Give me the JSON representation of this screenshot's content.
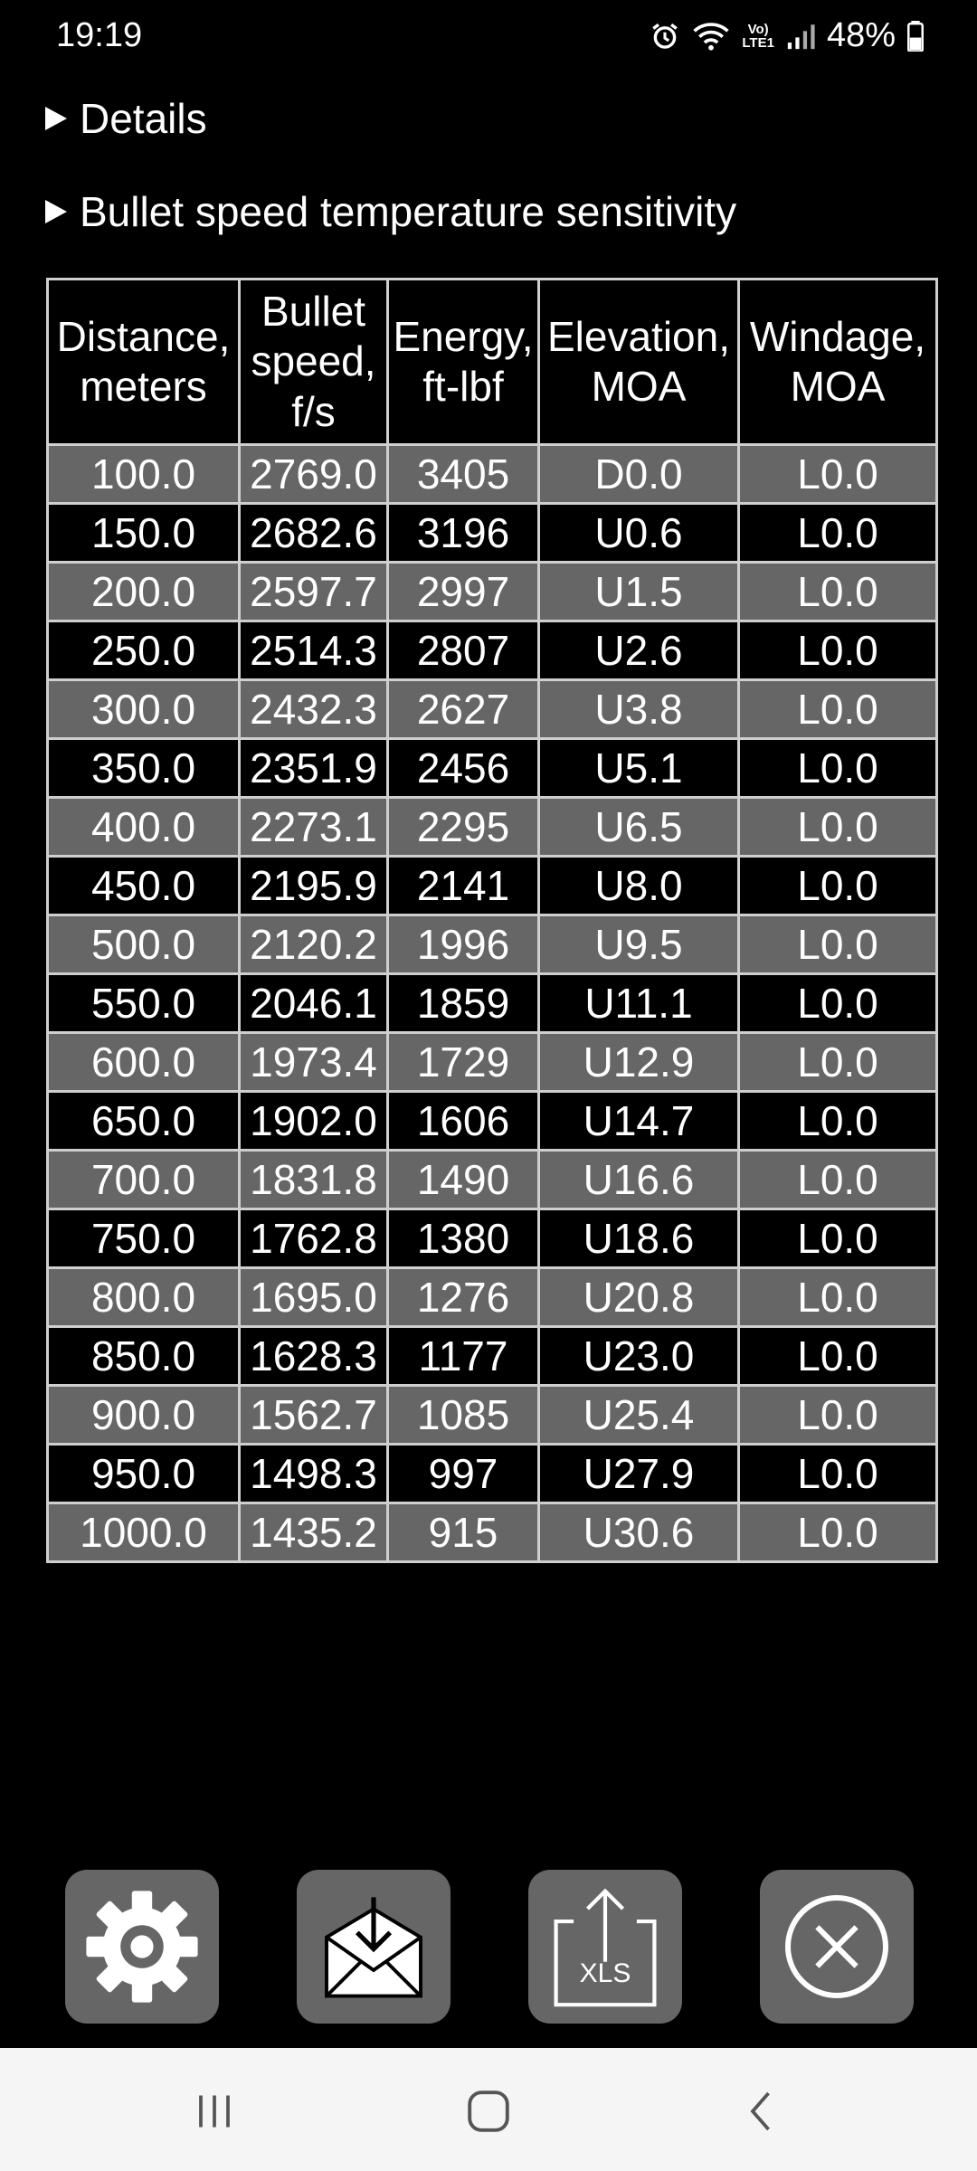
{
  "status_bar": {
    "time": "19:19",
    "net_top": "Vo)",
    "net_bottom": "LTE1",
    "battery": "48%"
  },
  "details": {
    "label": "Details"
  },
  "sensitivity": {
    "label": "Bullet speed temperature sensitivity"
  },
  "table": {
    "headers": [
      "Distance,\nmeters",
      "Bullet\nspeed,\nf/s",
      "Energy,\nft-lbf",
      "Elevation,\nMOA",
      "Windage,\nMOA"
    ],
    "rows": [
      [
        "100.0",
        "2769.0",
        "3405",
        "D0.0",
        "L0.0"
      ],
      [
        "150.0",
        "2682.6",
        "3196",
        "U0.6",
        "L0.0"
      ],
      [
        "200.0",
        "2597.7",
        "2997",
        "U1.5",
        "L0.0"
      ],
      [
        "250.0",
        "2514.3",
        "2807",
        "U2.6",
        "L0.0"
      ],
      [
        "300.0",
        "2432.3",
        "2627",
        "U3.8",
        "L0.0"
      ],
      [
        "350.0",
        "2351.9",
        "2456",
        "U5.1",
        "L0.0"
      ],
      [
        "400.0",
        "2273.1",
        "2295",
        "U6.5",
        "L0.0"
      ],
      [
        "450.0",
        "2195.9",
        "2141",
        "U8.0",
        "L0.0"
      ],
      [
        "500.0",
        "2120.2",
        "1996",
        "U9.5",
        "L0.0"
      ],
      [
        "550.0",
        "2046.1",
        "1859",
        "U11.1",
        "L0.0"
      ],
      [
        "600.0",
        "1973.4",
        "1729",
        "U12.9",
        "L0.0"
      ],
      [
        "650.0",
        "1902.0",
        "1606",
        "U14.7",
        "L0.0"
      ],
      [
        "700.0",
        "1831.8",
        "1490",
        "U16.6",
        "L0.0"
      ],
      [
        "750.0",
        "1762.8",
        "1380",
        "U18.6",
        "L0.0"
      ],
      [
        "800.0",
        "1695.0",
        "1276",
        "U20.8",
        "L0.0"
      ],
      [
        "850.0",
        "1628.3",
        "1177",
        "U23.0",
        "L0.0"
      ],
      [
        "900.0",
        "1562.7",
        "1085",
        "U25.4",
        "L0.0"
      ],
      [
        "950.0",
        "1498.3",
        "997",
        "U27.9",
        "L0.0"
      ],
      [
        "1000.0",
        "1435.2",
        "915",
        "U30.6",
        "L0.0"
      ]
    ]
  },
  "actions": {
    "export_label": "XLS"
  },
  "icons": {
    "settings": "gear-icon",
    "email": "envelope-download-icon",
    "export": "xls-export-icon",
    "close": "close-circle-icon",
    "nav_recent": "recent-apps-icon",
    "nav_home": "home-icon",
    "nav_back": "back-icon"
  },
  "colors": {
    "background": "#000000",
    "row_alt": "#666666",
    "grid": "#cfcfcf",
    "button": "#666666",
    "nav_bar": "#f5f5f5"
  }
}
